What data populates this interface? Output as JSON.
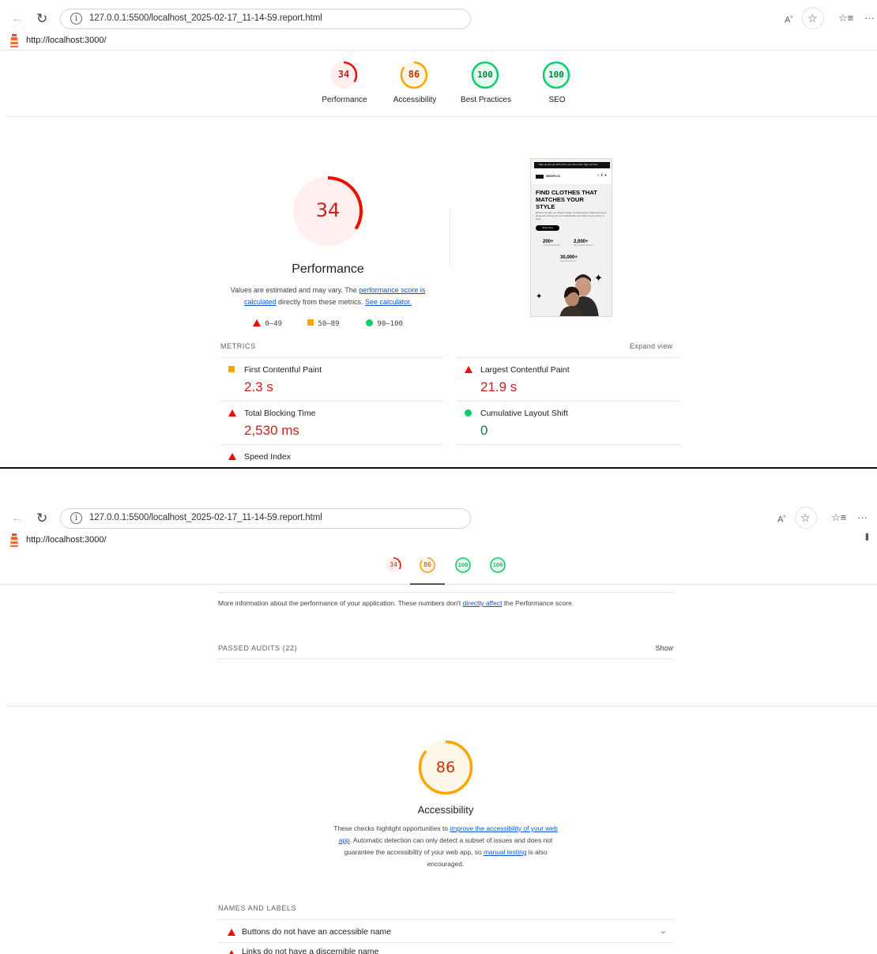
{
  "browser": {
    "url": "127.0.0.1:5500/localhost_2025-02-17_11-14-59.report.html",
    "page_url": "http://localhost:3000/"
  },
  "icons": {
    "back": "back-arrow-icon",
    "reload": "reload-icon",
    "info": "info-icon",
    "read_aloud": "read-aloud-icon",
    "favorite": "star-outline-icon",
    "favorites_list": "favorites-icon",
    "more": "more-dots-icon",
    "logo": "lighthouse-logo-icon"
  },
  "colors": {
    "fail": "#eb0f00",
    "fail_text": "#c5221f",
    "average": "#ffa400",
    "average_text": "#c33300",
    "pass": "#0cce6b",
    "pass_text": "#018642",
    "link": "#1155cc"
  },
  "scores": [
    {
      "label": "Performance",
      "value": "34",
      "score": 34
    },
    {
      "label": "Accessibility",
      "value": "86",
      "score": 86
    },
    {
      "label": "Best Practices",
      "value": "100",
      "score": 100
    },
    {
      "label": "SEO",
      "value": "100",
      "score": 100
    }
  ],
  "performance": {
    "score": "34",
    "title": "Performance",
    "desc_prefix": "Values are estimated and may vary. The ",
    "desc_link1": "performance score is calculated",
    "desc_mid": " directly from these metrics. ",
    "desc_link2": "See calculator.",
    "legend": [
      "0–49",
      "50–89",
      "90–100"
    ],
    "metrics_label": "METRICS",
    "expand_label": "Expand view",
    "metrics": [
      {
        "label": "First Contentful Paint",
        "value": "2.3 s",
        "rating": "average"
      },
      {
        "label": "Largest Contentful Paint",
        "value": "21.9 s",
        "rating": "fail"
      },
      {
        "label": "Total Blocking Time",
        "value": "2,530 ms",
        "rating": "fail"
      },
      {
        "label": "Cumulative Layout Shift",
        "value": "0",
        "rating": "pass"
      },
      {
        "label": "Speed Index",
        "rating": "fail"
      }
    ]
  },
  "thumbnail": {
    "promo": "Sign up and get 20% off to your first order. Sign Up Now",
    "brand": "SHOP.CO",
    "headline": [
      "FIND CLOTHES THAT",
      "MATCHES YOUR",
      "STYLE"
    ],
    "blurb": "Browse through our diverse range of meticulously crafted garments, designed to bring out your individuality and cater to your sense of style.",
    "button": "Shop Now",
    "stats": [
      {
        "value": "200+",
        "label": "International Brands"
      },
      {
        "value": "2,000+",
        "label": "High-Quality Products"
      },
      {
        "value": "30,000+",
        "label": "Happy Customers"
      }
    ]
  },
  "second": {
    "more_info_prefix": "More information about the performance of your application. These numbers don't ",
    "more_info_link": "directly affect",
    "more_info_suffix": " the Performance score.",
    "passed_audits": "PASSED AUDITS (22)",
    "show": "Show",
    "accessibility": {
      "score": "86",
      "title": "Accessibility",
      "desc1": "These checks highlight opportunities to ",
      "desc_link1": "improve the accessibility of your web app",
      "desc2": ". Automatic detection can only detect a subset of issues and does not guarantee the accessibility of your web app, so ",
      "desc_link2": "manual testing",
      "desc3": " is also encouraged."
    },
    "names_labels": "NAMES AND LABELS",
    "audit_1": "Buttons do not have an accessible name",
    "audit_2": "Links do not have a discernible name"
  }
}
